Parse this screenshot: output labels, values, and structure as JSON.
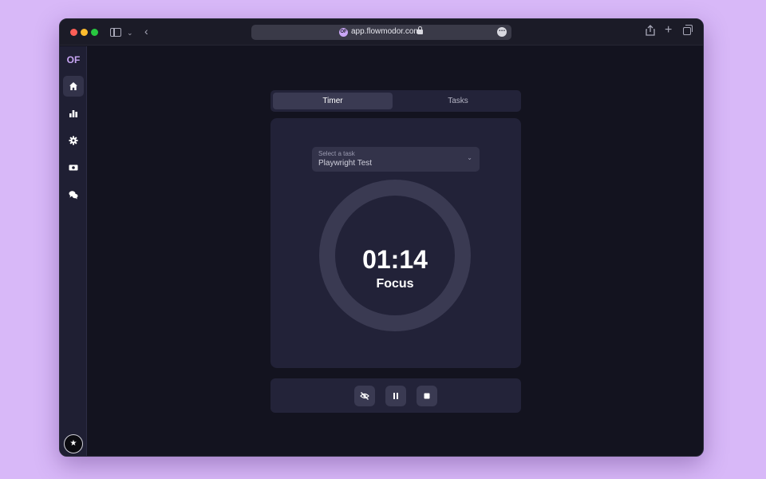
{
  "browser": {
    "url": "app.flowmodor.com",
    "favicon_text": "OF"
  },
  "sidebar": {
    "logo_text": "OF",
    "items": [
      {
        "name": "home",
        "active": true
      },
      {
        "name": "stats",
        "active": false
      },
      {
        "name": "settings",
        "active": false
      },
      {
        "name": "billing",
        "active": false
      },
      {
        "name": "feedback",
        "active": false
      }
    ]
  },
  "tabs": {
    "timer": "Timer",
    "tasks": "Tasks",
    "active": "Timer"
  },
  "task_select": {
    "label": "Select a task",
    "value": "Playwright Test"
  },
  "timer": {
    "time": "01:14",
    "mode": "Focus"
  },
  "controls": [
    "hide-timer",
    "pause",
    "stop"
  ],
  "colors": {
    "background": "#d8b8f8",
    "app_bg": "#13131f",
    "card_bg": "#222238",
    "accent": "#c9a6f5",
    "ring": "#3a3a52"
  }
}
